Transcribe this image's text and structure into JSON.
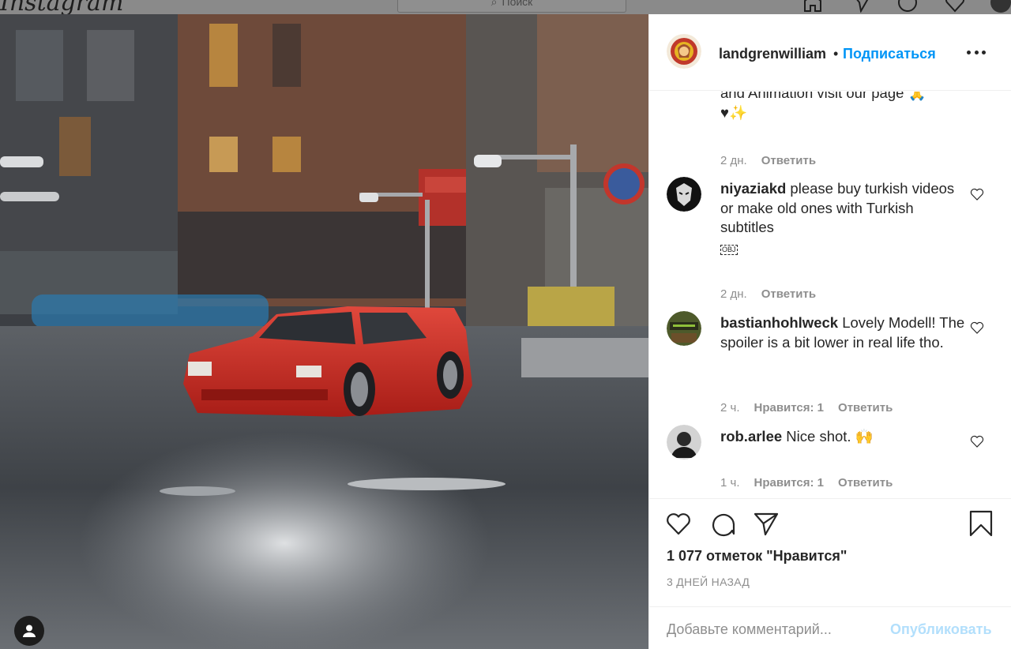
{
  "topbar": {
    "logo_text": "Instagram",
    "search_placeholder": "Поиск"
  },
  "post": {
    "author": "landgrenwilliam",
    "separator": "•",
    "follow_label": "Подписаться",
    "more_icon": "ellipsis-icon"
  },
  "comments": [
    {
      "text_line1": "and Animation visit our page 🙏",
      "text_line2": "♥✨",
      "time": "2 дн.",
      "reply_label": "Ответить"
    },
    {
      "username": "niyaziakd",
      "text": " please buy turkish videos or make old ones with Turkish subtitles",
      "obj_marker": "OBJ",
      "time": "2 дн.",
      "reply_label": "Ответить"
    },
    {
      "username": "bastianhohlweck",
      "text": " Lovely Modell! The spoiler is a bit lower in real life tho.",
      "time": "2 ч.",
      "likes_label": "Нравится: 1",
      "reply_label": "Ответить"
    },
    {
      "username": "rob.arlee",
      "text": " Nice shot. 🙌",
      "time": "1 ч.",
      "likes_label": "Нравится: 1",
      "reply_label": "Ответить"
    }
  ],
  "actions": {
    "likes_text": "1 077 отметок \"Нравится\"",
    "date_text": "3 ДНЕЙ НАЗАД"
  },
  "add_comment": {
    "placeholder": "Добавьте комментарий...",
    "publish_label": "Опубликовать"
  },
  "colors": {
    "accent": "#0095f6",
    "publish_disabled": "#b2dffc",
    "text_primary": "#262626",
    "text_secondary": "#8e8e8e"
  }
}
